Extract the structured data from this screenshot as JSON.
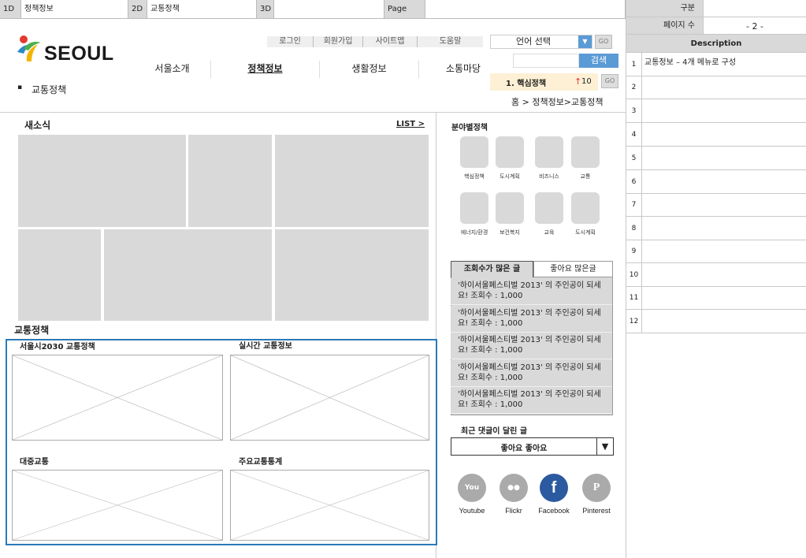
{
  "pathbar": {
    "d1_label": "1D",
    "d1_value": "정책정보",
    "d2_label": "2D",
    "d2_value": "교통정책",
    "d3_label": "3D",
    "d3_value": "",
    "page_label": "Page",
    "page_value": ""
  },
  "right_panel": {
    "gubun_label": "구분",
    "gubun_value": "",
    "pages_label": "페이지 수",
    "pages_value": "- 2 -",
    "desc_header": "Description",
    "rows": [
      {
        "num": "1",
        "text": "교통정보 – 4개 메뉴로 구성"
      },
      {
        "num": "2",
        "text": ""
      },
      {
        "num": "3",
        "text": ""
      },
      {
        "num": "4",
        "text": ""
      },
      {
        "num": "5",
        "text": ""
      },
      {
        "num": "6",
        "text": ""
      },
      {
        "num": "7",
        "text": ""
      },
      {
        "num": "8",
        "text": ""
      },
      {
        "num": "9",
        "text": ""
      },
      {
        "num": "10",
        "text": ""
      },
      {
        "num": "11",
        "text": ""
      },
      {
        "num": "12",
        "text": ""
      }
    ]
  },
  "header": {
    "logo_text": "SEOUL",
    "top_links": [
      "로그인",
      "회원가입",
      "사이트맵",
      "도움말"
    ],
    "lang_select": "언어 선택",
    "go_label": "GO",
    "search_label": "검색",
    "gnb": [
      "서울소개",
      "정책정보",
      "생활정보",
      "소통마당"
    ],
    "rank_text": "1. 핵심정책",
    "rank_arrow": "↑",
    "rank_num": "10",
    "rank_go": "GO",
    "breadcrumb": "홈 > 정책정보>교통정책",
    "sub_title": "교통정책",
    "bullet": "▪"
  },
  "news": {
    "title": "새소식",
    "list_link": "LIST >"
  },
  "traffic": {
    "title": "교통정책",
    "items": [
      "서울시2030 교통정책",
      "실시간 교통정보",
      "대중교통",
      "주요교통통계"
    ]
  },
  "categories": {
    "title": "분야별정책",
    "items": [
      "핵심정책",
      "도시계획",
      "비즈니스",
      "교통",
      "에너지/환경",
      "보건복지",
      "교육",
      "도시계획"
    ]
  },
  "tabs": {
    "tab1": "조회수가 많은 글",
    "tab2": "좋아요 많은글",
    "items": [
      "'하이서울페스티벌 2013' 의 주인공이 되세요! 조회수 : 1,000",
      "'하이서울페스티벌 2013' 의 주인공이 되세요! 조회수 : 1,000",
      "'하이서울페스티벌 2013' 의 주인공이 되세요! 조회수 : 1,000",
      "'하이서울페스티벌 2013' 의 주인공이 되세요! 조회수 : 1,000",
      "'하이서울페스티벌 2013' 의 주인공이 되세요! 조회수 : 1,000"
    ]
  },
  "recent": {
    "title": "최근 댓글이 달린 글",
    "select_value": "좋아요 좋아요",
    "arrow": "▼"
  },
  "sns": [
    {
      "label": "Youtube",
      "glyph": "You"
    },
    {
      "label": "Flickr",
      "glyph": "●●"
    },
    {
      "label": "Facebook",
      "glyph": "f"
    },
    {
      "label": "Pinterest",
      "glyph": "P"
    }
  ],
  "colors": {
    "accent_blue": "#2a7ab8",
    "facebook": "#2c5aa0",
    "rank_bg": "#fdf0d5",
    "search_btn": "#5b9bd5"
  }
}
